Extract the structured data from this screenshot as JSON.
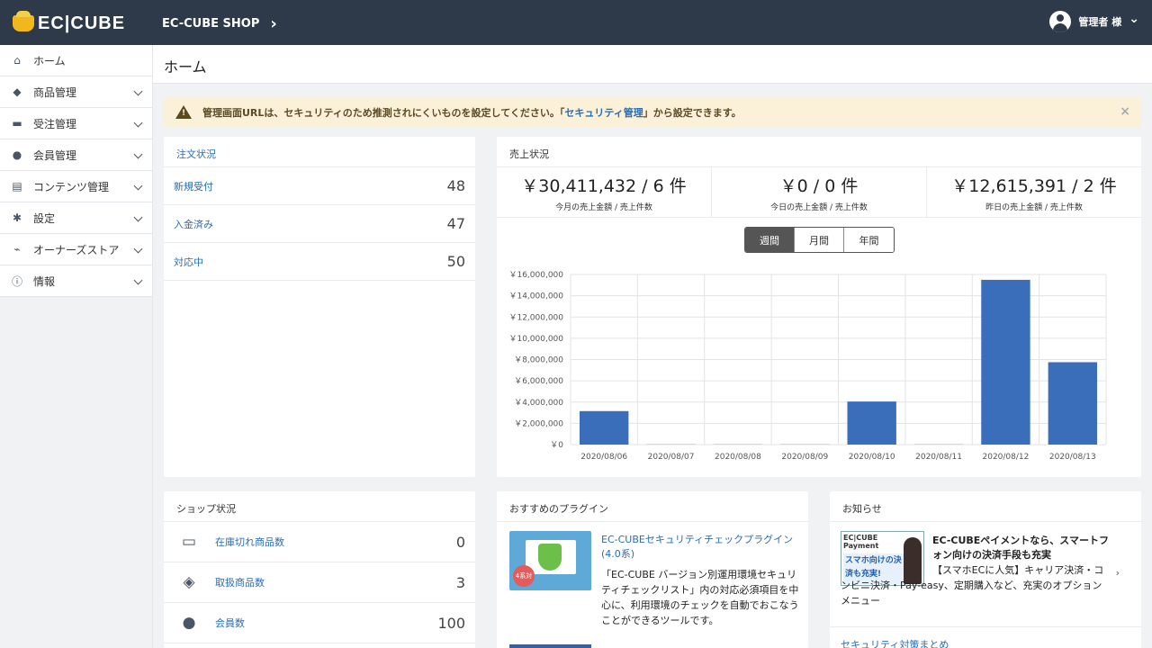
{
  "header": {
    "logo": "EC|CUBE",
    "shop_name": "EC-CUBE SHOP",
    "shop_arrow": "›",
    "user": "管理者 様",
    "user_caret": "⌄"
  },
  "sidebar": {
    "items": [
      {
        "icon": "home-icon",
        "glyph": "⌂",
        "label": "ホーム"
      },
      {
        "icon": "box-icon",
        "glyph": "◆",
        "label": "商品管理"
      },
      {
        "icon": "cart-icon",
        "glyph": "▬",
        "label": "受注管理"
      },
      {
        "icon": "users-icon",
        "glyph": "●",
        "label": "会員管理"
      },
      {
        "icon": "file-icon",
        "glyph": "▤",
        "label": "コンテンツ管理"
      },
      {
        "icon": "gear-icon",
        "glyph": "✱",
        "label": "設定"
      },
      {
        "icon": "plug-icon",
        "glyph": "⌁",
        "label": "オーナーズストア"
      },
      {
        "icon": "info-icon",
        "glyph": "ⓘ",
        "label": "情報"
      }
    ]
  },
  "page": {
    "title": "ホーム"
  },
  "alert": {
    "text_before": "管理画面URLは、セキュリティのため推測されにくいものを設定してください。「",
    "link": "セキュリティ管理",
    "text_after": "」から設定できます。",
    "close": "×"
  },
  "orders": {
    "title": "注文状況",
    "rows": [
      {
        "label": "新規受付",
        "value": "48"
      },
      {
        "label": "入金済み",
        "value": "47"
      },
      {
        "label": "対応中",
        "value": "50"
      }
    ]
  },
  "sales": {
    "title": "売上状況",
    "summary": [
      {
        "amount": "￥30,411,432 / 6 件",
        "caption": "今月の売上金額 / 売上件数"
      },
      {
        "amount": "￥0 / 0 件",
        "caption": "今日の売上金額 / 売上件数"
      },
      {
        "amount": "￥12,615,391 / 2 件",
        "caption": "昨日の売上金額 / 売上件数"
      }
    ],
    "tabs": [
      "週間",
      "月間",
      "年間"
    ],
    "active_tab": "週間"
  },
  "chart_data": {
    "type": "bar",
    "categories": [
      "2020/08/06",
      "2020/08/07",
      "2020/08/08",
      "2020/08/09",
      "2020/08/10",
      "2020/08/11",
      "2020/08/12",
      "2020/08/13"
    ],
    "values": [
      3150000,
      0,
      0,
      0,
      4050000,
      0,
      15500000,
      7750000
    ],
    "ylim": [
      0,
      16000000
    ],
    "yticks": [
      "￥16,000,000",
      "￥14,000,000",
      "￥12,000,000",
      "￥10,000,000",
      "￥8,000,000",
      "￥6,000,000",
      "￥4,000,000",
      "￥2,000,000",
      "￥0"
    ],
    "bar_color": "#3a6eba",
    "grid": true
  },
  "shop": {
    "title": "ショップ状況",
    "rows": [
      {
        "icon": "inbox-icon",
        "glyph": "▭",
        "label": "在庫切れ商品数",
        "value": "0"
      },
      {
        "icon": "cubes-icon",
        "glyph": "◈",
        "label": "取扱商品数",
        "value": "3"
      },
      {
        "icon": "members-icon",
        "glyph": "●",
        "label": "会員数",
        "value": "100"
      }
    ]
  },
  "plugins": {
    "title": "おすすめのプラグイン",
    "item": {
      "title": "EC-CUBEセキュリティチェックプラグイン(4.0系)",
      "badge": "4系対応",
      "desc": "「EC-CUBE バージョン別運用環境セキュリティチェックリスト」内の対応必須項目を中心に、利用環境のチェックを自動でおこなうことができるツールです。"
    }
  },
  "news": {
    "title": "お知らせ",
    "image_brand": "EC|CUBE Payment",
    "image_text": "スマホ向けの決済も充実!",
    "item_title": "EC-CUBEペイメントなら、スマートフォン向けの決済手段も充実",
    "item_desc": "【スマホECに人気】キャリア決済・コンビニ決済・Pay-easy、定期購入など、充実のオプションメニュー",
    "chev": "›",
    "link": "セキュリティ対策まとめ"
  }
}
